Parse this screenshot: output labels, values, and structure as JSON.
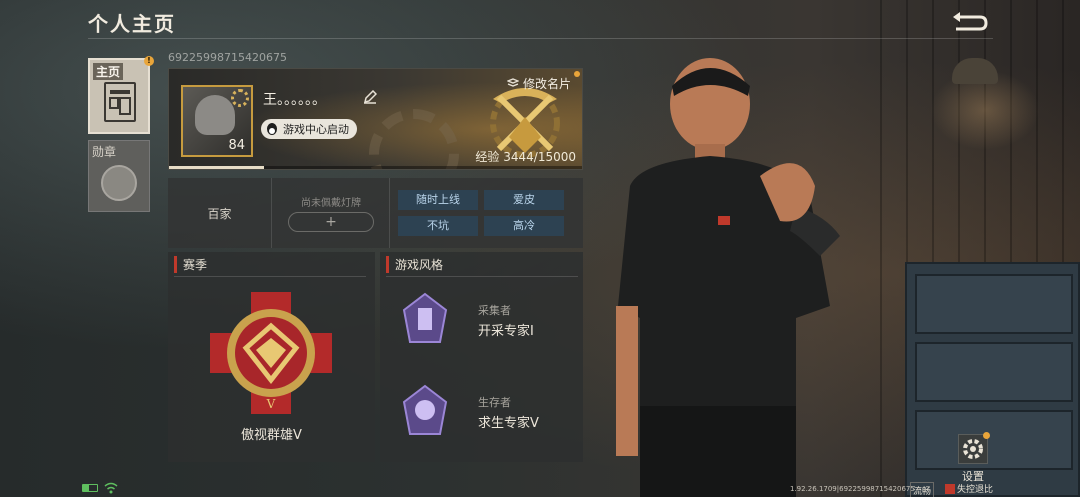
{
  "header": {
    "title": "个人主页"
  },
  "tabs": [
    {
      "label": "主页",
      "active": true,
      "badge": "!"
    },
    {
      "label": "勋章",
      "active": false
    }
  ],
  "profile": {
    "player_id": "69225998715420675",
    "name": "王。。。。。。",
    "level": "84",
    "launch_badge": "游戏中心启动",
    "modify_card": "修改名片",
    "exp_text": "经验 3444/15000",
    "exp_current": 3444,
    "exp_max": 15000
  },
  "info": {
    "faction": "百家",
    "lamp_label": "尚未佩戴灯牌",
    "lamp_add": "+",
    "tags": [
      "随时上线",
      "爱皮",
      "不坑",
      "高冷"
    ]
  },
  "season": {
    "title": "赛季",
    "rank_name": "傲视群雄Ⅴ"
  },
  "play_style": {
    "title": "游戏风格",
    "items": [
      {
        "label": "采集者",
        "value": "开采专家Ⅰ"
      },
      {
        "label": "生存者",
        "value": "求生专家Ⅴ"
      }
    ]
  },
  "settings": {
    "label": "设置"
  },
  "status_bar": {
    "version": "1.92.26.1709|69225998715420675",
    "smooth": "流畅",
    "lost": "失控退比"
  },
  "colors": {
    "accent_gold": "#c69b3f",
    "tag_bg": "#2d4252",
    "tag_text": "#b9d4ea",
    "title_bar": "#c0392b"
  },
  "icons": {
    "back": "back-arrow-icon",
    "edit": "pencil-icon",
    "qq": "qq-penguin-icon",
    "settings": "gear-icon",
    "wifi": "wifi-icon",
    "battery": "battery-icon"
  }
}
